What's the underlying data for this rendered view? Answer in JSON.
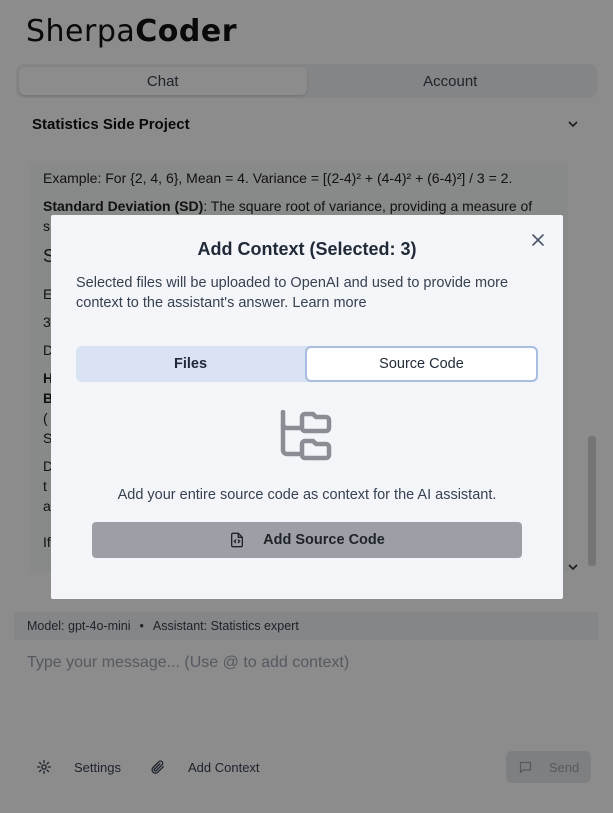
{
  "app": {
    "logo_light": "Sherpa",
    "logo_bold": "Coder"
  },
  "tabs": [
    {
      "label": "Chat",
      "active": true
    },
    {
      "label": "Account",
      "active": false
    }
  ],
  "project": {
    "name": "Statistics Side Project"
  },
  "chat": {
    "line1": "Example: For {2, 4, 6}, Mean = 4. Variance = [(2-4)² + (4-4)² + (6-4)²] / 3 = 2.",
    "line2_bold": "Standard Deviation (SD)",
    "line2_rest": ": The square root of variance, providing a measure of",
    "line3": "s",
    "partial": [
      "S",
      "E",
      "3",
      "D",
      "H",
      "B",
      "(",
      "S",
      "D",
      "t",
      "a",
      "If"
    ]
  },
  "status": {
    "model": "Model: gpt-4o-mini",
    "separator": "•",
    "assistant": "Assistant: Statistics expert"
  },
  "composer": {
    "placeholder": "Type your message... (Use @ to add context)"
  },
  "bottom": {
    "settings": "Settings",
    "add_context": "Add Context",
    "send": "Send"
  },
  "modal": {
    "title": "Add Context (Selected: 3)",
    "description": "Selected files will be uploaded to OpenAI and used to provide more context to the assistant's answer. Learn more",
    "tabs": [
      {
        "label": "Files",
        "active": false
      },
      {
        "label": "Source Code",
        "active": true
      }
    ],
    "subtitle": "Add your entire source code as context for the AI assistant.",
    "button": "Add Source Code"
  },
  "icons": {
    "close": "close-icon",
    "folder_tree": "folder-tree-icon",
    "file_code": "file-code-icon",
    "gear": "gear-icon",
    "paperclip": "paperclip-icon",
    "message": "message-square-icon",
    "chevron": "chevron-down-icon"
  },
  "colors": {
    "modal_bg": "#f3f5f8",
    "segment_bg": "#d8e2f3",
    "segment_active_border": "#a9bde0",
    "button_bg": "#9ca0a6"
  }
}
